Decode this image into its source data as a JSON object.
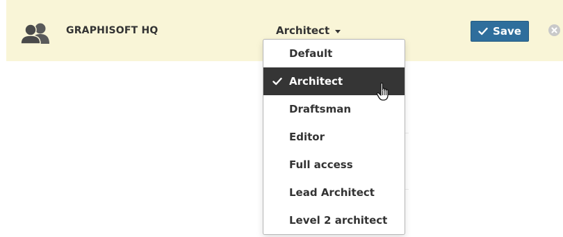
{
  "group": {
    "icon": "group-users-icon",
    "name": "GRAPHISOFT HQ"
  },
  "role_select": {
    "current_value": "Architect",
    "icon": "caret-down-icon"
  },
  "save_button": {
    "label": "Save",
    "icon": "checkmark-icon"
  },
  "close_button": {
    "icon": "close-circle-icon"
  },
  "dropdown": {
    "selected_icon": "checkmark-icon",
    "items": [
      {
        "label": "Default",
        "selected": false
      },
      {
        "label": "Architect",
        "selected": true
      },
      {
        "label": "Draftsman",
        "selected": false
      },
      {
        "label": "Editor",
        "selected": false
      },
      {
        "label": "Full access",
        "selected": false
      },
      {
        "label": "Lead Architect",
        "selected": false
      },
      {
        "label": "Level 2 architect",
        "selected": false
      }
    ]
  },
  "cursor": {
    "icon": "hand-pointer-icon"
  },
  "colors": {
    "row_background": "#f9f5d7",
    "accent_button": "#2f6e9c",
    "selected_item_background": "#353535",
    "text": "#333333",
    "close_icon": "#c9c9c9"
  }
}
